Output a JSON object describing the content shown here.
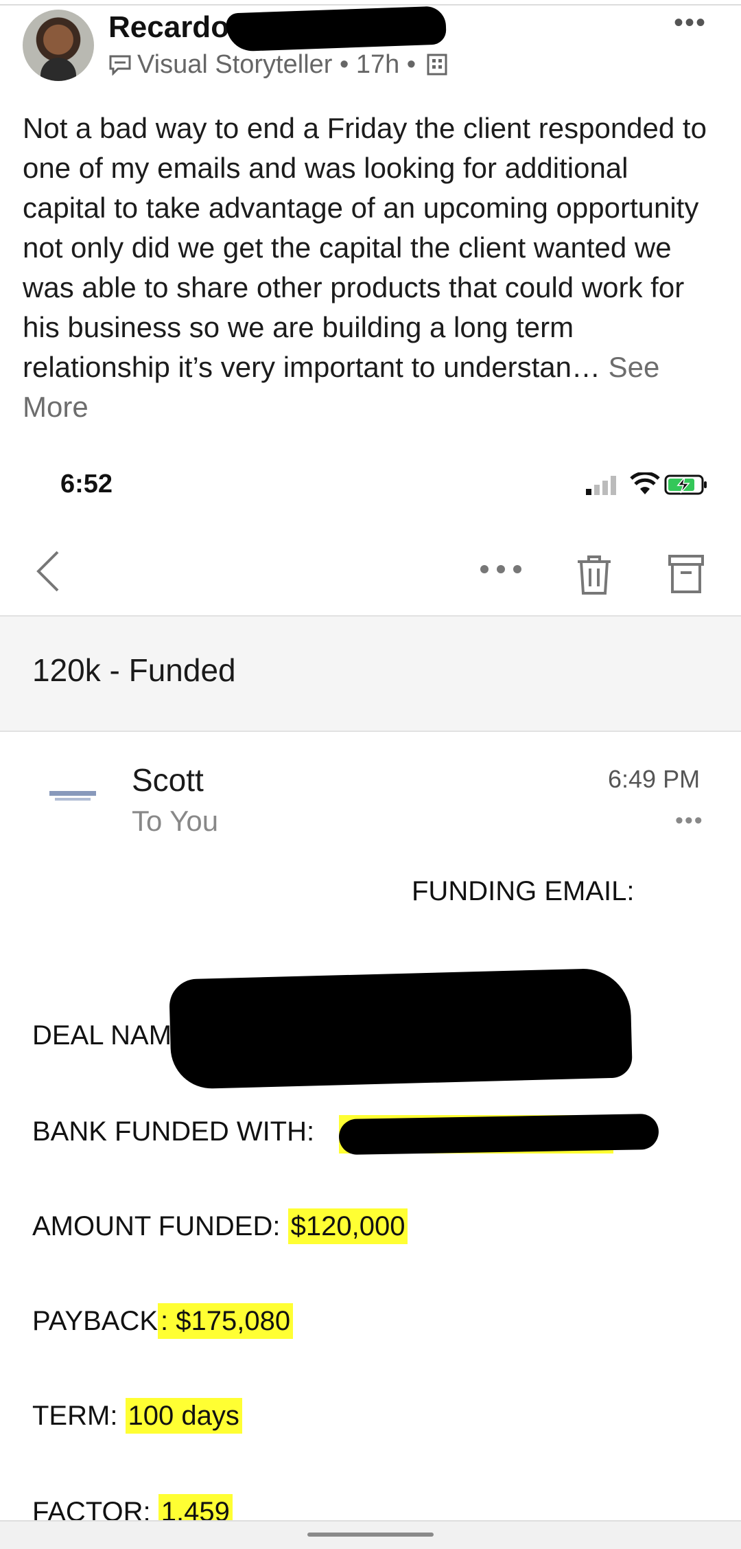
{
  "post": {
    "author_name": "Recardo",
    "author_subtitle": "Visual Storyteller • 17h •",
    "body": "Not a bad way to end a Friday the client responded to one of my emails and was looking for additional capital to take advantage of an upcoming opportunity not only did we get the capital the client wanted we was able to share other products that could work for his business so we are building a long term relationship it’s very important to understan…",
    "see_more": "See More",
    "more_menu": "•••"
  },
  "phone": {
    "status_time": "6:52"
  },
  "email": {
    "subject": "120k - Funded",
    "sender": "Scott",
    "recipient": "To You",
    "time": "6:49 PM",
    "row_dots": "•••",
    "heading": "FUNDING EMAIL:",
    "fields": {
      "deal_label": "DEAL NAME: ",
      "bank_label": "BANK FUNDED WITH:",
      "amount_label": "AMOUNT FUNDED: ",
      "amount_value": "$120,000",
      "payback_label": "PAYBACK",
      "payback_value": ": $175,080",
      "term_label": "TERM: ",
      "term_value": "100 days",
      "factor_label": "FACTOR: ",
      "factor_value": "1.459"
    }
  },
  "colors": {
    "highlight": "#ffff33",
    "battery": "#34c759"
  },
  "icons": [
    "speech-bubble-icon",
    "building-icon",
    "signal-icon",
    "wifi-icon",
    "battery-icon",
    "back-chevron-icon",
    "more-icon",
    "trash-icon",
    "archive-icon"
  ]
}
